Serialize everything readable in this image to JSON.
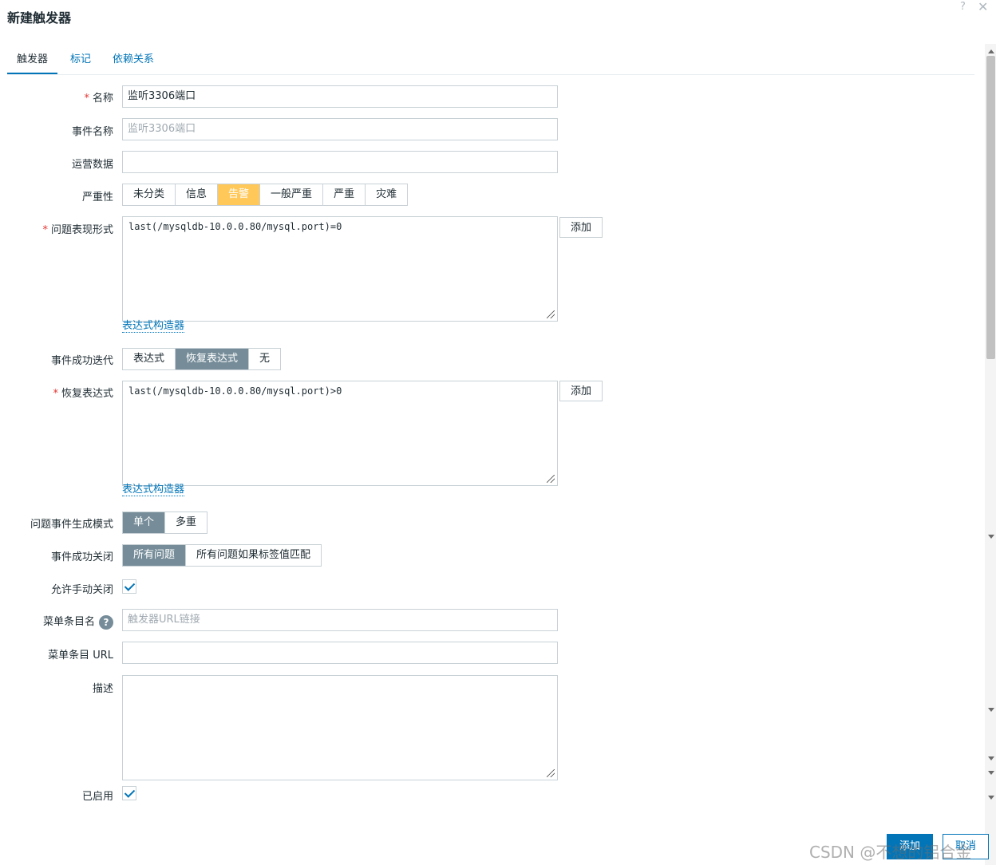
{
  "dialog": {
    "title": "新建触发器",
    "help_glyph": "?",
    "close_glyph": "✕"
  },
  "tabs": [
    {
      "label": "触发器",
      "active": true
    },
    {
      "label": "标记",
      "active": false
    },
    {
      "label": "依赖关系",
      "active": false
    }
  ],
  "form": {
    "required_mark": "*",
    "name": {
      "label": "名称",
      "value": "监听3306端口"
    },
    "event_name": {
      "label": "事件名称",
      "placeholder": "监听3306端口"
    },
    "opdata": {
      "label": "运营数据",
      "value": ""
    },
    "severity": {
      "label": "严重性",
      "options": [
        "未分类",
        "信息",
        "告警",
        "一般严重",
        "严重",
        "灾难"
      ],
      "selected": "告警",
      "selected_color": "#ffc859"
    },
    "problem_expr": {
      "label": "问题表现形式",
      "value": "last(/mysqldb-10.0.0.80/mysql.port)=0",
      "add_label": "添加",
      "builder_link": "表达式构造器"
    },
    "ok_event_gen": {
      "label": "事件成功迭代",
      "options": [
        "表达式",
        "恢复表达式",
        "无"
      ],
      "selected": "恢复表达式"
    },
    "recovery_expr": {
      "label": "恢复表达式",
      "value": "last(/mysqldb-10.0.0.80/mysql.port)>0",
      "add_label": "添加",
      "builder_link": "表达式构造器"
    },
    "problem_mode": {
      "label": "问题事件生成模式",
      "options": [
        "单个",
        "多重"
      ],
      "selected": "单个"
    },
    "ok_close": {
      "label": "事件成功关闭",
      "options": [
        "所有问题",
        "所有问题如果标签值匹配"
      ],
      "selected": "所有问题"
    },
    "manual_close": {
      "label": "允许手动关闭",
      "checked": true
    },
    "url_name": {
      "label": "菜单条目名",
      "placeholder": "触发器URL链接",
      "help_glyph": "?"
    },
    "url": {
      "label": "菜单条目 URL",
      "value": ""
    },
    "description": {
      "label": "描述",
      "value": ""
    },
    "enabled": {
      "label": "已启用",
      "checked": true
    }
  },
  "footer": {
    "add_label": "添加",
    "cancel_label": "取消"
  },
  "watermark": "CSDN @不想的铝合金",
  "colors": {
    "accent": "#0275b8",
    "selected_segment": "#768d99",
    "required": "#e33734"
  }
}
